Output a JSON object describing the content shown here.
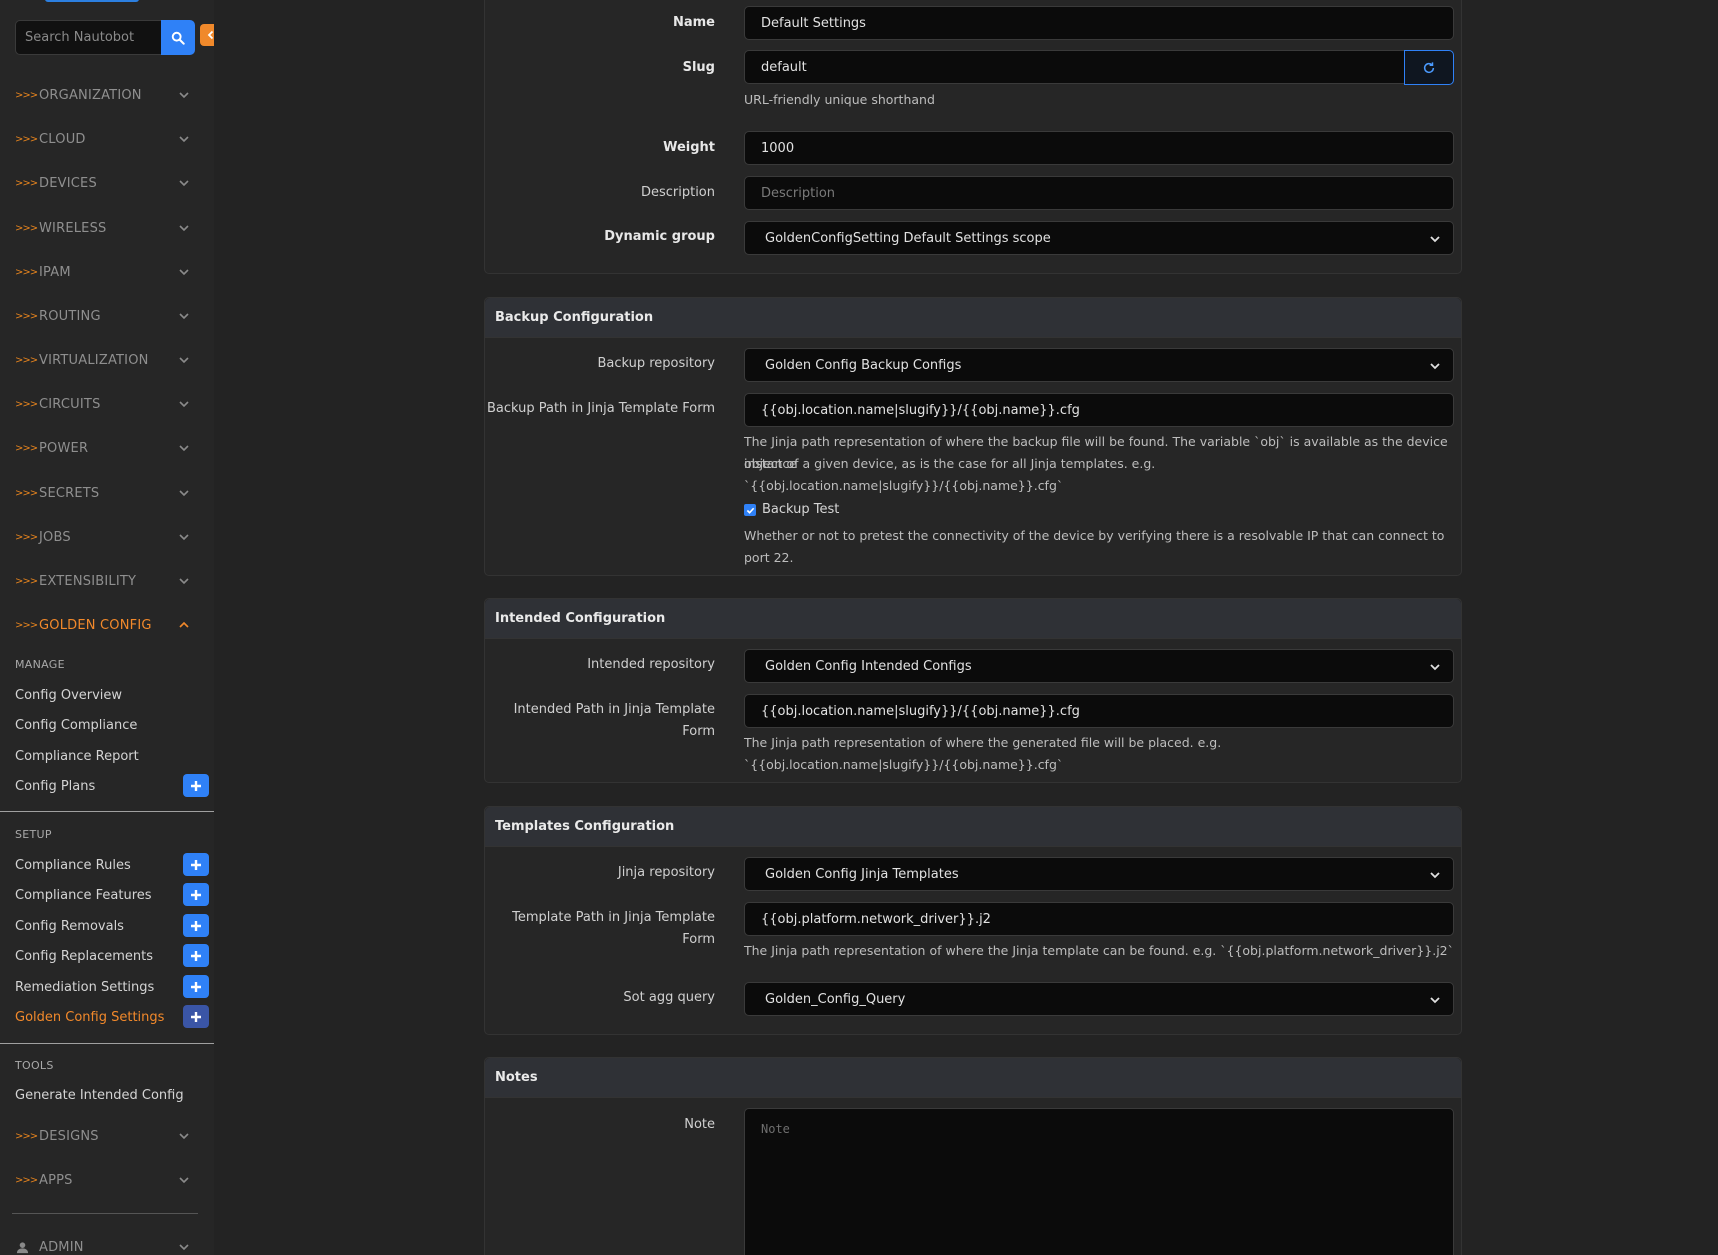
{
  "sidebar": {
    "search_placeholder": "Search Nautobot",
    "sections": [
      {
        "label": "ORGANIZATION"
      },
      {
        "label": "CLOUD"
      },
      {
        "label": "DEVICES"
      },
      {
        "label": "WIRELESS"
      },
      {
        "label": "IPAM"
      },
      {
        "label": "ROUTING"
      },
      {
        "label": "VIRTUALIZATION"
      },
      {
        "label": "CIRCUITS"
      },
      {
        "label": "POWER"
      },
      {
        "label": "SECRETS"
      },
      {
        "label": "JOBS"
      },
      {
        "label": "EXTENSIBILITY"
      },
      {
        "label": "GOLDEN CONFIG"
      }
    ],
    "section_arrows": ">>>",
    "golden_config": {
      "manage_title": "MANAGE",
      "manage_items": [
        {
          "label": "Config Overview"
        },
        {
          "label": "Config Compliance"
        },
        {
          "label": "Compliance Report"
        },
        {
          "label": "Config Plans"
        }
      ],
      "setup_title": "SETUP",
      "setup_items": [
        {
          "label": "Compliance Rules"
        },
        {
          "label": "Compliance Features"
        },
        {
          "label": "Config Removals"
        },
        {
          "label": "Config Replacements"
        },
        {
          "label": "Remediation Settings"
        },
        {
          "label": "Golden Config Settings"
        }
      ],
      "tools_title": "TOOLS",
      "tools_items": [
        {
          "label": "Generate Intended Config"
        }
      ]
    },
    "bottom_sections": [
      {
        "label": "DESIGNS"
      },
      {
        "label": "APPS"
      }
    ],
    "admin_label": "ADMIN"
  },
  "general": {
    "name_label": "Name",
    "name_value": "Default Settings",
    "slug_label": "Slug",
    "slug_value": "default",
    "slug_help": "URL-friendly unique shorthand",
    "weight_label": "Weight",
    "weight_value": "1000",
    "description_label": "Description",
    "description_placeholder": "Description",
    "dynamic_group_label": "Dynamic group",
    "dynamic_group_value": "GoldenConfigSetting Default Settings scope"
  },
  "backup": {
    "header": "Backup Configuration",
    "repo_label": "Backup repository",
    "repo_value": "Golden Config Backup Configs",
    "path_label": "Backup Path in Jinja Template Form",
    "path_value": "{{obj.location.name|slugify}}/{{obj.name}}.cfg",
    "path_help_1": "The Jinja path representation of where the backup file will be found. The variable `obj` is available as the device instance",
    "path_help_2": "object of a given device, as is the case for all Jinja templates. e.g. `{{obj.location.name|slugify}}/{{obj.name}}.cfg`",
    "test_label": "Backup Test",
    "test_help": "Whether or not to pretest the connectivity of the device by verifying there is a resolvable IP that can connect to port 22."
  },
  "intended": {
    "header": "Intended Configuration",
    "repo_label": "Intended repository",
    "repo_value": "Golden Config Intended Configs",
    "path_label_1": "Intended Path in Jinja Template",
    "path_label_2": "Form",
    "path_value": "{{obj.location.name|slugify}}/{{obj.name}}.cfg",
    "path_help": "The Jinja path representation of where the generated file will be placed. e.g. `{{obj.location.name|slugify}}/{{obj.name}}.cfg`"
  },
  "templates": {
    "header": "Templates Configuration",
    "repo_label": "Jinja repository",
    "repo_value": "Golden Config Jinja Templates",
    "path_label_1": "Template Path in Jinja Template",
    "path_label_2": "Form",
    "path_value": "{{obj.platform.network_driver}}.j2",
    "path_help": "The Jinja path representation of where the Jinja template can be found. e.g. `{{obj.platform.network_driver}}.j2`",
    "sot_label": "Sot agg query",
    "sot_value": "Golden_Config_Query"
  },
  "notes": {
    "header": "Notes",
    "note_label": "Note",
    "note_placeholder": "Note"
  },
  "colors": {
    "accent_orange": "#f2892b",
    "accent_blue": "#2f81f7"
  }
}
